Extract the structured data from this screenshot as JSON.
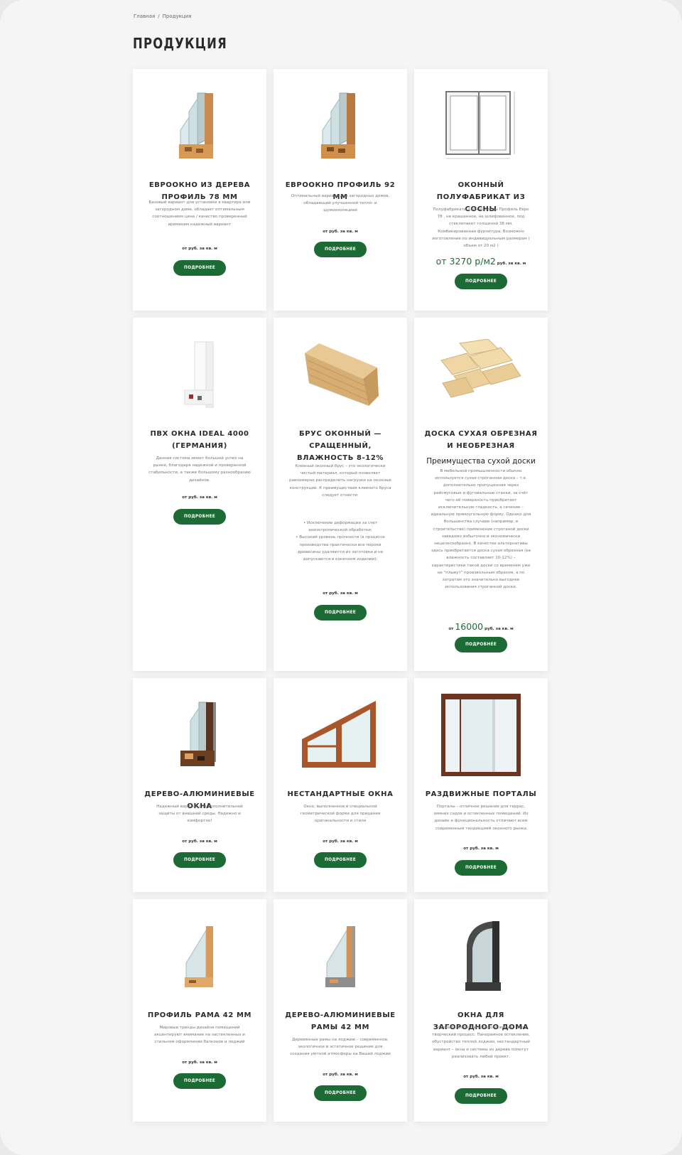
{
  "breadcrumb": {
    "home": "Главная",
    "separator": "/",
    "current": "Продукция"
  },
  "page_title": "ПРОДУКЦИЯ",
  "colors": {
    "accent": "#1d6b34",
    "card_bg": "#ffffff",
    "page_bg": "#f5f5f5"
  },
  "products": [
    {
      "title": "ЕВРООКНО ИЗ ДЕРЕВА ПРОФИЛЬ 78 ММ",
      "description": "Базовый вариант для установки в квартире или загородном доме, обладает оптимальным соотношением цена / качество проверенный временем надежный вариант",
      "price": "от руб. за кв. м",
      "button": "ПОДРОБНЕЕ",
      "icon": "wood-window-profile-icon"
    },
    {
      "title": "ЕВРООКНО ПРОФИЛЬ 92 ММ",
      "description": "Оптимальный вариант для загородных домов, обладающий улучшенной тепло- и шумоизоляцией",
      "price": "от руб. за кв. м",
      "button": "ПОДРОБНЕЕ",
      "icon": "wood-window-profile-icon"
    },
    {
      "title": "ОКОННЫЙ ПОЛУФАБРИКАТ ИЗ СОСНЫ",
      "description": "Полуфабрикаты окон из сосны Профиль Евро 78 , не крашенное, не шлифованное, под стеклопакет толщиной 38 мм. Комбинированная фурнитура. Возможно изготовление по индивидуальным размерам ( объем от 20 м2 )",
      "price_prefix": "от",
      "price_value": "от 3270 р/м2",
      "price_suffix": "руб. за кв. м",
      "button": "ПОДРОБНЕЕ",
      "icon": "window-drawing-icon"
    },
    {
      "title": "ПВХ ОКНА IDEAL 4000 (ГЕРМАНИЯ)",
      "description": "Данная система имеет большой успех на рынке, благодаря надежной и проверенной стабильности, а также большому разнообразию дизайнов.",
      "price": "от руб. за кв. м",
      "button": "ПОДРОБНЕЕ",
      "icon": "pvc-window-profile-icon"
    },
    {
      "title": "БРУС ОКОННЫЙ — СРАЩЕННЫЙ, ВЛАЖНОСТЬ 8-12%",
      "description": "Клееный оконный брус – это экологически чистый материал, который позволяет равномерно распределить нагрузки на оконные конструкции. К преимуществам клееного бруса следует отнести:",
      "bullets": [
        "• Исключение деформации за счет анизотропической обработки;",
        "• Высокий уровень прочности (в процессе производства практически все пороки древесины удаляются из заготовки и не допускаются в конечном изделии);"
      ],
      "price": "от руб. за кв. м",
      "button": "ПОДРОБНЕЕ",
      "icon": "glued-beam-icon"
    },
    {
      "title": "ДОСКА СУХАЯ ОБРЕЗНАЯ И НЕОБРЕЗНАЯ",
      "subhead": "Преимущества сухой доски",
      "description": "В мебельной промышленности обычно используется сухая строганная доска – т.е. дополнительно пропущенная через рейсмусовые и фуговальные станки, за счёт чего её поверхность приобретает исключительную гладкость, а сечение – идеальную прямоугольную форму. Однако для большинства случаев (например, в строительстве) применение строганой доски заведомо избыточно и экономически нецелесообразно. В качестве альтернативы здесь приобретается доска сухая обрезная (ее влажность составляет 10-12%) – характеристики такой доски со временем уже не \"плывут\" произвольным образом, а по затратам это значительно выгоднее использования строганной доски.",
      "price_prefix": "от",
      "price_value": "16000",
      "price_suffix": "руб. за кв. м",
      "button": "ПОДРОБНЕЕ",
      "icon": "planks-icon"
    },
    {
      "title": "ДЕРЕВО-АЛЮМИНИЕВЫЕ ОКНА",
      "description": "Надежный вариант для дополнительной защиты от внешней среды. Надежно и комфортно!",
      "price": "от руб. за кв. м",
      "button": "ПОДРОБНЕЕ",
      "icon": "wood-aluminium-profile-icon"
    },
    {
      "title": "НЕСТАНДАРТНЫЕ ОКНА",
      "description": "Окно, выполненное в специальной геометрической форме для придания оригинальности и стиля",
      "price": "от руб. за кв. м",
      "button": "ПОДРОБНЕЕ",
      "icon": "trapezoid-window-icon"
    },
    {
      "title": "РАЗДВИЖНЫЕ ПОРТАЛЫ",
      "description": "Порталы – отличное решение для террас, зимних садов и остекленных помещений. Их дизайн и функциональность отличают всем современным тенденциям оконного рынка",
      "price": "от руб. за кв. м",
      "button": "ПОДРОБНЕЕ",
      "icon": "sliding-portal-icon"
    },
    {
      "title": "ПРОФИЛЬ РАМА 42 ММ",
      "description": "Мировые тренды дизайна помещений акцентируют внимание на застекленных и стильном оформлении балконов и лоджий",
      "price": "от руб. за кв. м",
      "button": "ПОДРОБНЕЕ",
      "icon": "frame-profile-icon"
    },
    {
      "title": "ДЕРЕВО-АЛЮМИНИЕВЫЕ РАМЫ 42 ММ",
      "description": "Деревянные рамы на лоджию – современное, экологичное и эстетичное решение для создания уютной атмосферы на Вашей лоджии",
      "price": "от руб. за кв. м",
      "button": "ПОДРОБНЕЕ",
      "icon": "aluminium-frame-profile-icon"
    },
    {
      "title": "ОКНА ДЛЯ ЗАГОРОДНОГО ДОМА",
      "description": "Строительство загородного жилья – это творческий процесс. Панорамное остекление, обустройство теплой лоджии, нестандартный вариант – окна и системы из дерева помогут реализовать любой проект.",
      "price": "от руб. за кв. м",
      "button": "ПОДРОБНЕЕ",
      "icon": "dark-window-profile-icon"
    }
  ]
}
